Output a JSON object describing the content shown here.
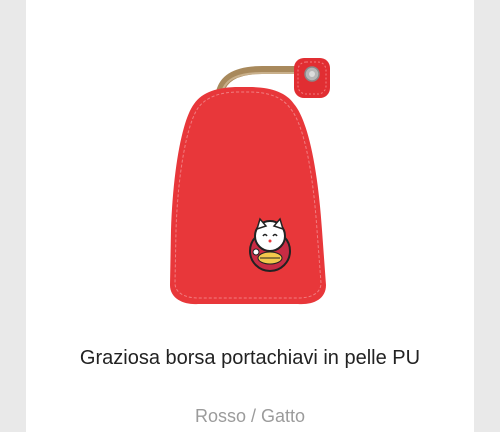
{
  "product": {
    "title": "Graziosa borsa portachiavi in pelle PU",
    "variant": "Rosso / Gatto",
    "image_icon": "key-pouch-image",
    "colors": {
      "leather": "#e5383b",
      "strap": "#a8895c",
      "background": "#e9e9e9",
      "card": "#ffffff"
    }
  }
}
